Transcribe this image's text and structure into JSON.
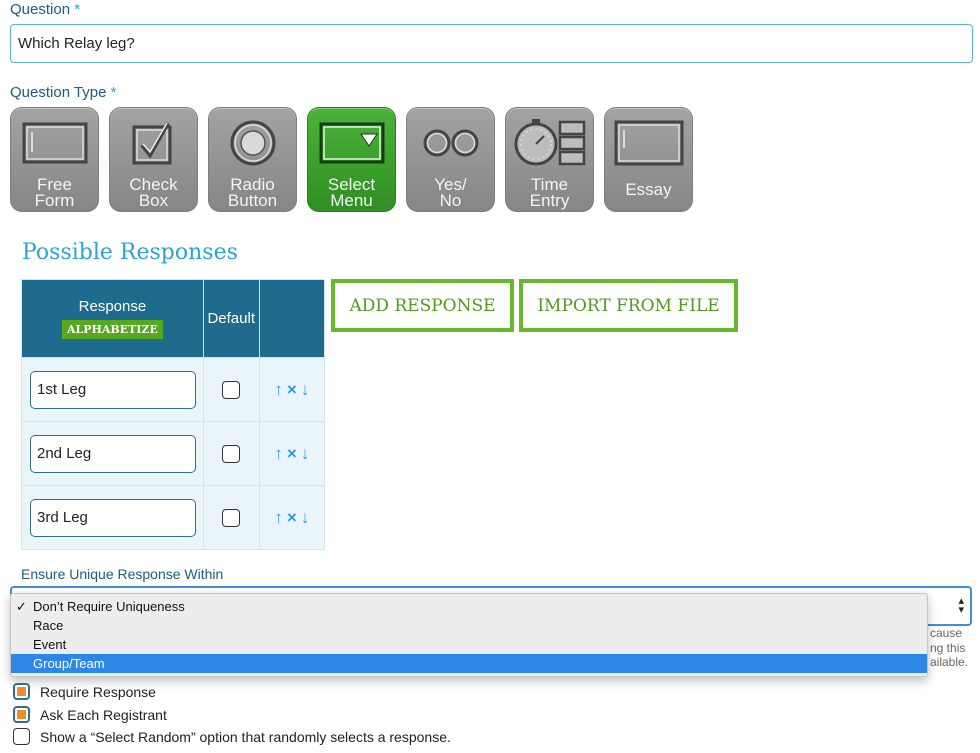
{
  "question": {
    "label": "Question",
    "required_mark": "*",
    "value": "Which Relay leg?"
  },
  "question_type": {
    "label": "Question Type",
    "required_mark": "*",
    "options": [
      {
        "label": "Free\nForm",
        "icon": "free-form-icon"
      },
      {
        "label": "Check\nBox",
        "icon": "checkbox-icon"
      },
      {
        "label": "Radio\nButton",
        "icon": "radio-button-icon"
      },
      {
        "label": "Select\nMenu",
        "icon": "select-menu-icon",
        "active": true
      },
      {
        "label": "Yes/\nNo",
        "icon": "yes-no-icon"
      },
      {
        "label": "Time\nEntry",
        "icon": "time-entry-icon"
      },
      {
        "label": "Essay",
        "icon": "essay-icon"
      }
    ]
  },
  "possible_responses": {
    "title": "Possible Responses",
    "col_response": "Response",
    "alphabetize": "ALPHABETIZE",
    "col_default": "Default",
    "rows": [
      {
        "value": "1st Leg"
      },
      {
        "value": "2nd Leg"
      },
      {
        "value": "3rd Leg"
      }
    ],
    "actions": {
      "up": "↑",
      "remove": "×",
      "down": "↓"
    },
    "add_button": "ADD RESPONSE",
    "import_button": "IMPORT FROM FILE"
  },
  "uniqueness": {
    "label": "Ensure Unique Response Within",
    "options": [
      {
        "label": "Don’t Require Uniqueness",
        "checked": true
      },
      {
        "label": "Race"
      },
      {
        "label": "Event"
      },
      {
        "label": "Group/Team",
        "highlighted": true
      }
    ],
    "checkmark": "✓",
    "side_text": [
      "cause",
      "ng this",
      "ailable."
    ]
  },
  "checkboxes": {
    "require_response": "Require Response",
    "ask_each": "Ask Each Registrant",
    "select_random": "Show a “Select Random” option that randomly selects a response."
  },
  "colors": {
    "accent_blue": "#2aa3d6",
    "header_blue": "#1f6b8d",
    "green": "#6ab82e",
    "orange": "#f08a2c",
    "select_highlight": "#2e86e6"
  }
}
